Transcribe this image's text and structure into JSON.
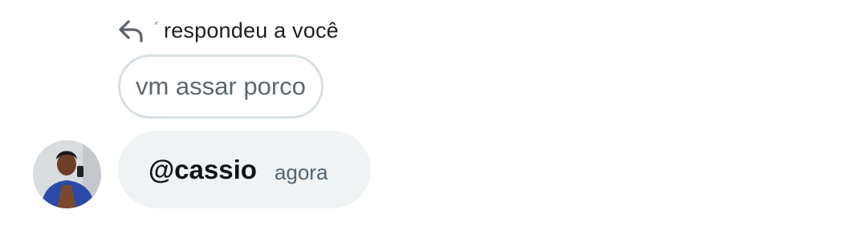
{
  "reply_header": {
    "text": "respondeu a você",
    "icon": "reply-arrow-icon"
  },
  "quoted_message": {
    "text": "vm assar porco"
  },
  "message": {
    "handle": "@cassio",
    "time": "agora",
    "avatar_icon": "user-avatar"
  },
  "colors": {
    "bubble_bg": "#eff3f4",
    "quoted_border": "#d7dfe3",
    "primary_text": "#0f1419",
    "secondary_text": "#536471"
  }
}
